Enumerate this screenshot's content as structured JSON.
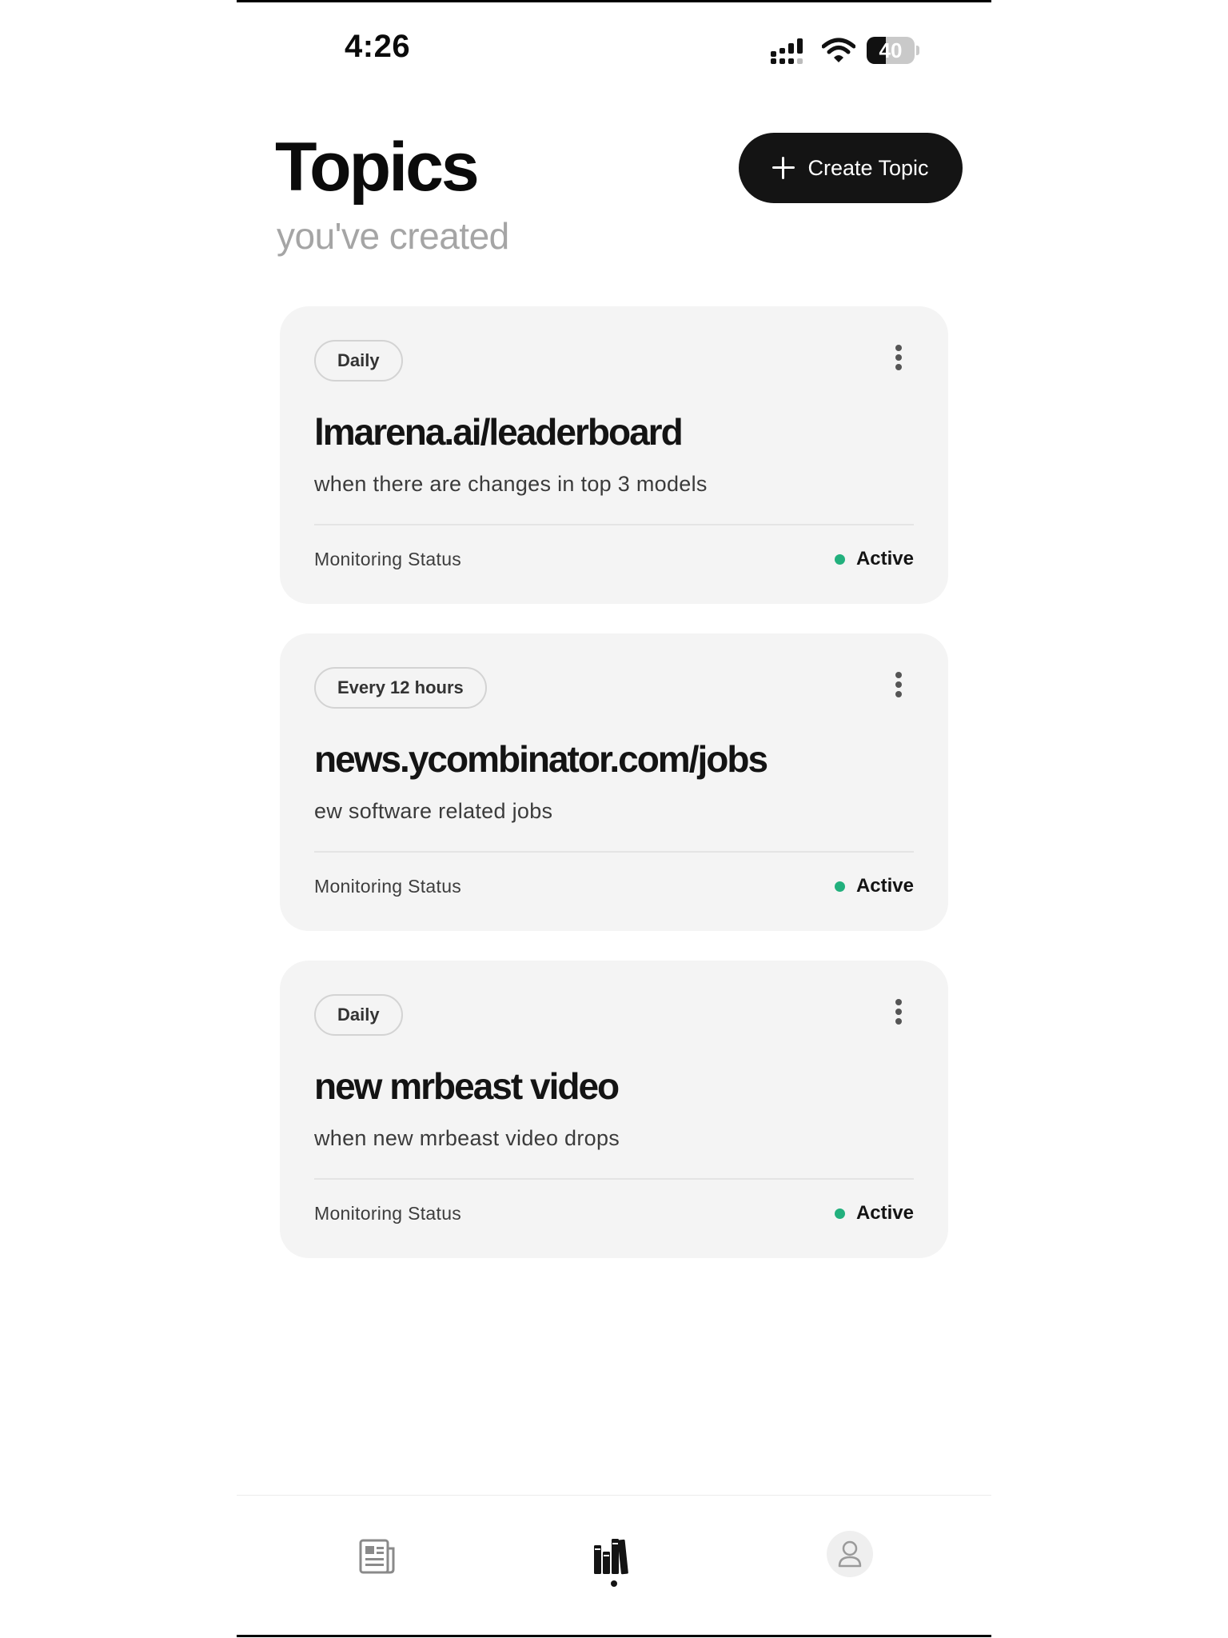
{
  "status_bar": {
    "time": "4:26",
    "battery": "40"
  },
  "header": {
    "title": "Topics",
    "subtitle": "you've created",
    "create_label": "Create Topic"
  },
  "topics": [
    {
      "frequency": "Daily",
      "title": "lmarena.ai/leaderboard",
      "description": "when there are changes in top 3 models",
      "monitor_label": "Monitoring Status",
      "status": "Active"
    },
    {
      "frequency": "Every 12 hours",
      "title": "news.ycombinator.com/jobs",
      "description": "ew software related jobs",
      "monitor_label": "Monitoring Status",
      "status": "Active"
    },
    {
      "frequency": "Daily",
      "title": "new mrbeast video",
      "description": "when new mrbeast video drops",
      "monitor_label": "Monitoring Status",
      "status": "Active"
    }
  ],
  "colors": {
    "accent": "#141414",
    "active": "#22b07d",
    "card_bg": "#f4f4f4",
    "subtitle": "#a5a5a5"
  },
  "nav": [
    {
      "icon": "newspaper-icon",
      "active": false
    },
    {
      "icon": "library-icon",
      "active": true
    },
    {
      "icon": "profile-icon",
      "active": false
    }
  ]
}
